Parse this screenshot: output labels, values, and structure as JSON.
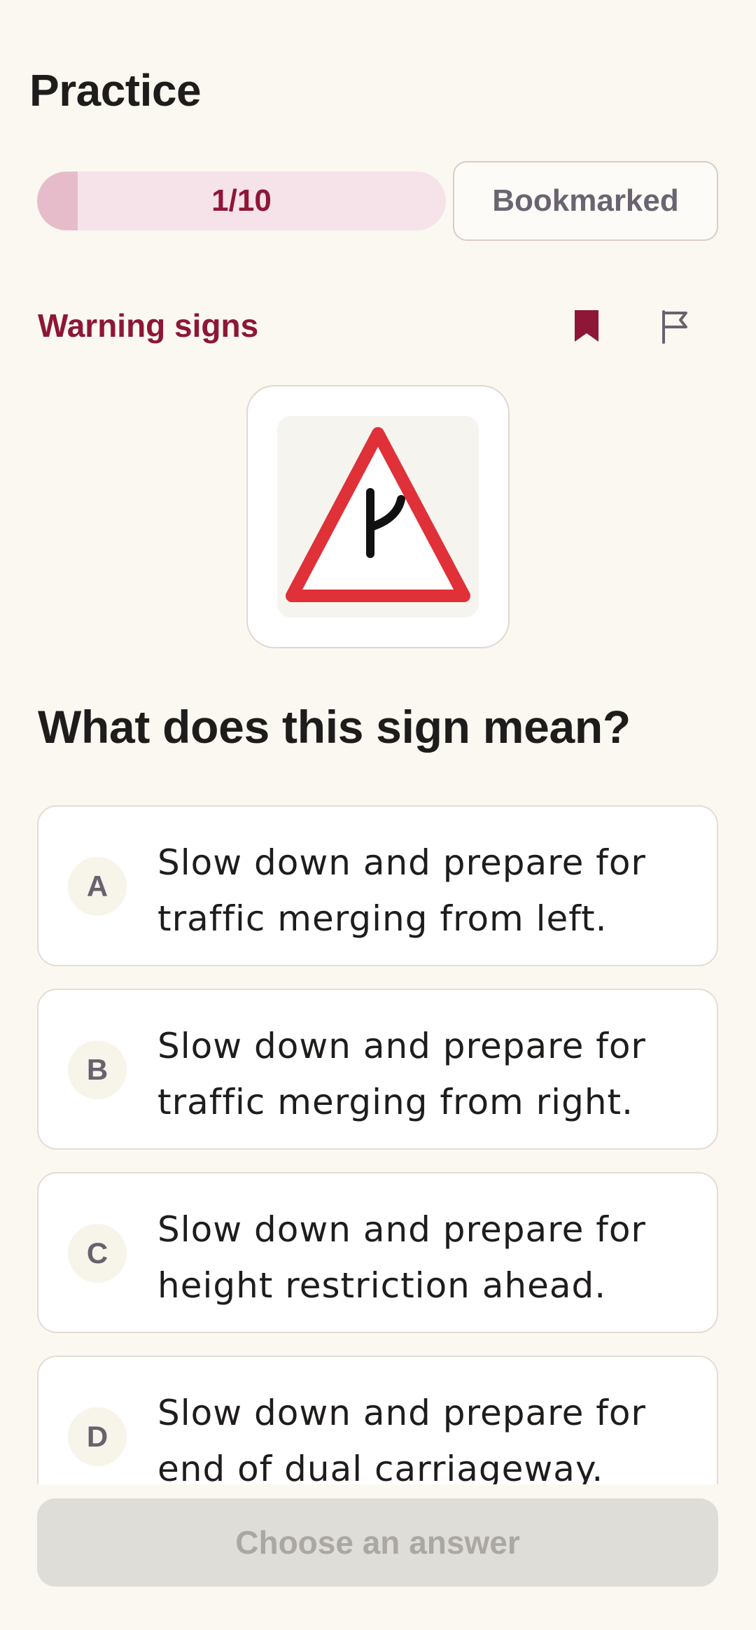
{
  "header": {
    "title": "Practice"
  },
  "progress": {
    "label": "1/10",
    "fraction": 0.1
  },
  "bookmarked_label": "Bookmarked",
  "category": "Warning signs",
  "icons": {
    "bookmark": "bookmark-filled-icon",
    "flag": "flag-outline-icon"
  },
  "question": "What does this sign mean?",
  "options": [
    {
      "letter": "A",
      "text": "Slow down and prepare for traffic merging from left."
    },
    {
      "letter": "B",
      "text": "Slow down and prepare for traffic merging from right."
    },
    {
      "letter": "C",
      "text": "Slow down and prepare for height restriction ahead."
    },
    {
      "letter": "D",
      "text": "Slow down and prepare for end of dual carriageway."
    }
  ],
  "cta_label": "Choose an answer",
  "colors": {
    "accent": "#8e1636",
    "background": "#faf8f1",
    "sign_border": "#e03038"
  }
}
